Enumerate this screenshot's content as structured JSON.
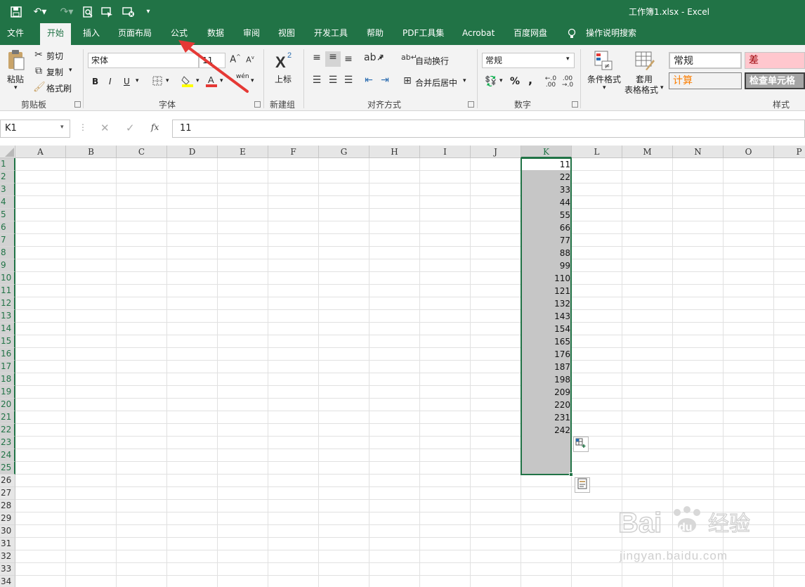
{
  "title_bar": {
    "document_title": "工作簿1.xlsx  -  Excel"
  },
  "quick_access": [
    {
      "icon": "save-icon"
    },
    {
      "icon": "undo-icon"
    },
    {
      "icon": "redo-icon"
    },
    {
      "icon": "print-preview-icon"
    },
    {
      "icon": "touch-mode-icon"
    },
    {
      "icon": "customize-icon"
    }
  ],
  "tabs": [
    "文件",
    "开始",
    "插入",
    "页面布局",
    "公式",
    "数据",
    "审阅",
    "视图",
    "开发工具",
    "帮助",
    "PDF工具集",
    "Acrobat",
    "百度网盘",
    "操作说明搜索"
  ],
  "active_tab": "开始",
  "ribbon": {
    "clipboard": {
      "paste": "粘贴",
      "cut": "剪切",
      "copy": "复制",
      "format_painter": "格式刷",
      "label": "剪贴板"
    },
    "font": {
      "font_name": "宋体",
      "font_size": "11",
      "bold": "B",
      "italic": "I",
      "underline": "U",
      "phonetic": "wén",
      "label": "字体"
    },
    "new_group": {
      "superscript": "上标",
      "label": "新建组"
    },
    "alignment": {
      "wrap_text": "自动换行",
      "merge_center": "合并后居中",
      "label": "对齐方式"
    },
    "number": {
      "format": "常规",
      "percent": "%",
      "comma": ",",
      "label": "数字"
    },
    "styles": {
      "conditional_format": "条件格式",
      "table_format_1": "套用",
      "table_format_2": "表格格式",
      "normal": "常规",
      "bad": "差",
      "calc": "计算",
      "check_cell": "检查单元格",
      "label": "样式"
    }
  },
  "formula_bar": {
    "name_box": "K1",
    "fx": "fx",
    "value": "11"
  },
  "columns": [
    "A",
    "B",
    "C",
    "D",
    "E",
    "F",
    "G",
    "H",
    "I",
    "J",
    "K",
    "L",
    "M",
    "N",
    "O",
    "P"
  ],
  "selected_column": "K",
  "rows": [
    "1",
    "2",
    "3",
    "4",
    "5",
    "6",
    "7",
    "8",
    "9",
    "10",
    "11",
    "12",
    "13",
    "14",
    "15",
    "16",
    "17",
    "18",
    "19",
    "20",
    "21",
    "22",
    "23",
    "24",
    "25",
    "26",
    "27",
    "28",
    "29",
    "30",
    "31",
    "32",
    "33",
    "34"
  ],
  "column_k_values": [
    "11",
    "22",
    "33",
    "44",
    "55",
    "66",
    "77",
    "88",
    "99",
    "110",
    "121",
    "132",
    "143",
    "154",
    "165",
    "176",
    "187",
    "198",
    "209",
    "220",
    "231",
    "242"
  ],
  "watermark": {
    "brand": "Bai du 经验",
    "url": "jingyan.baidu.com"
  },
  "colors": {
    "excel_green": "#217346",
    "selection_fill": "#c6c6c6",
    "arrow_red": "#e53935",
    "bad_fill": "#ffc7ce",
    "bad_text": "#9c0006",
    "calc_text": "#fa7d00"
  }
}
